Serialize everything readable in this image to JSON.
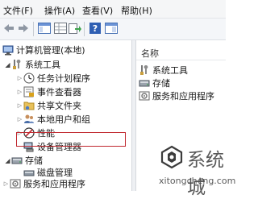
{
  "menubar": {
    "file": "文件(F)",
    "action": "操作(A)",
    "view": "查看(V)",
    "help": "帮助(H)"
  },
  "toolbar": {
    "icons": [
      "back-arrow-icon",
      "forward-arrow-icon",
      "show-tree-icon",
      "export-icon",
      "help-icon",
      "panel-icon"
    ]
  },
  "tree": {
    "root": "计算机管理(本地)",
    "system_tools": "系统工具",
    "task_scheduler": "任务计划程序",
    "event_viewer": "事件查看器",
    "shared_folders": "共享文件夹",
    "local_users": "本地用户和组",
    "performance": "性能",
    "device_manager": "设备管理器",
    "storage": "存储",
    "disk_management": "磁盘管理",
    "services_apps": "服务和应用程序"
  },
  "right_pane": {
    "column_header": "名称",
    "items": [
      "系统工具",
      "存储",
      "服务和应用程序"
    ]
  },
  "watermark": {
    "text": "系统城",
    "url": "xitongcheng.com"
  },
  "colors": {
    "highlight_border": "#c0282f",
    "toolbar_bg": "#f4f6f9"
  }
}
